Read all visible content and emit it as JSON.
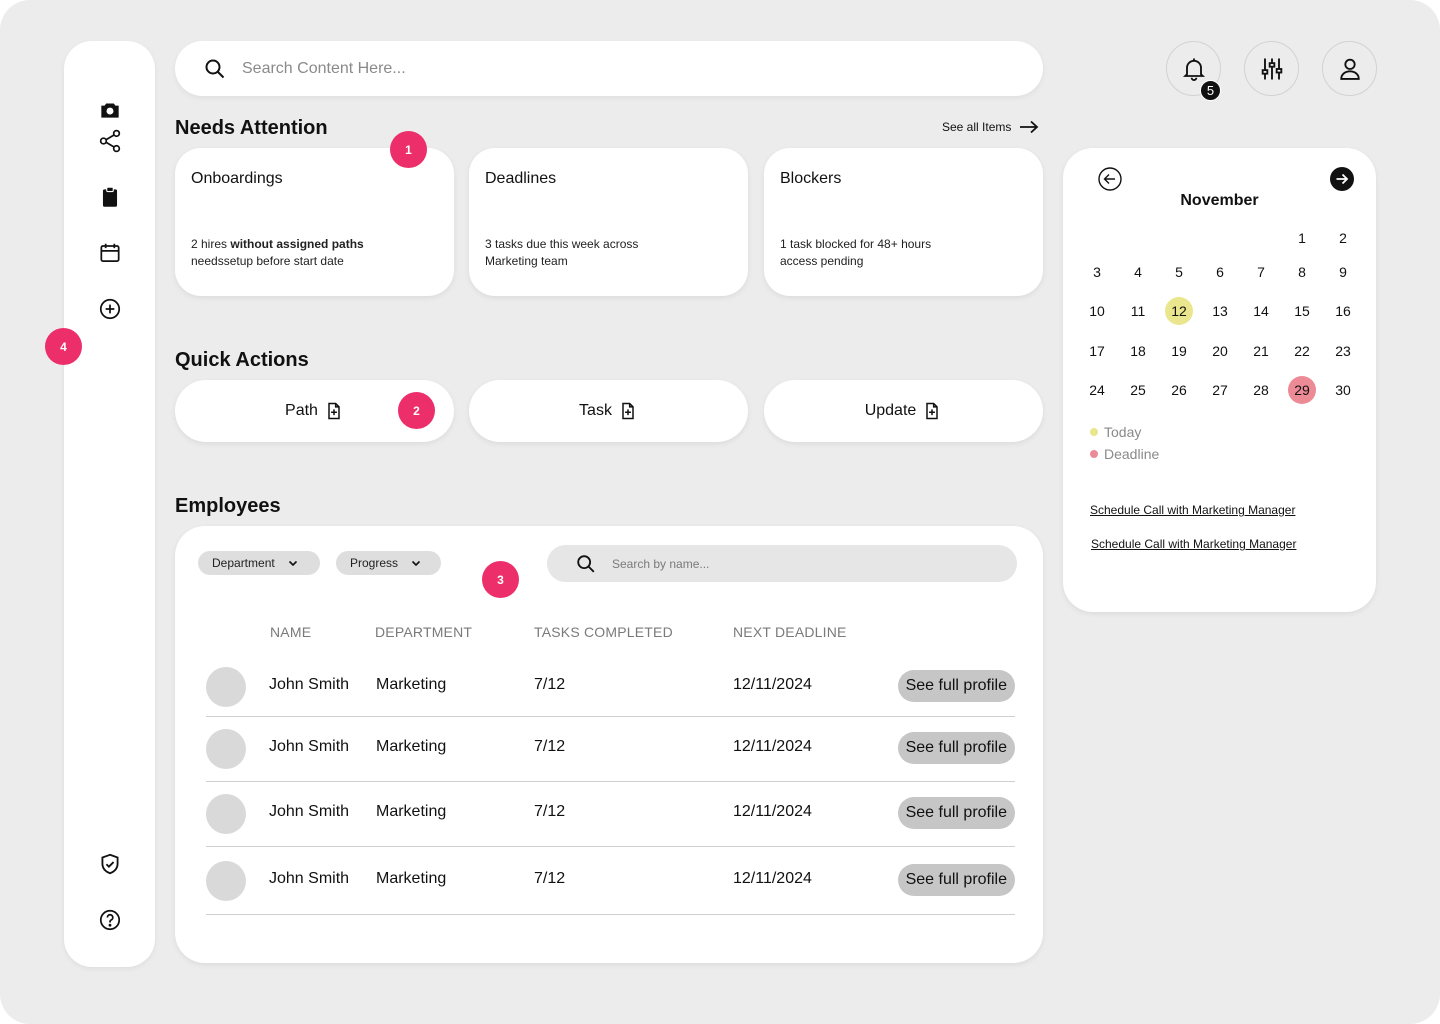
{
  "search": {
    "placeholder": "Search Content Here..."
  },
  "notifications": {
    "count": "5"
  },
  "needs_attention": {
    "title": "Needs Attention",
    "see_all": "See all Items",
    "cards": [
      {
        "title": "Onboardings",
        "desc_pre": "2 hires ",
        "desc_bold": "without assigned paths",
        "desc_post": "needssetup before start date"
      },
      {
        "title": "Deadlines",
        "desc_line1": "3 tasks due this week across",
        "desc_line2": "Marketing team"
      },
      {
        "title": "Blockers",
        "desc_line1": "1 task blocked for 48+ hours",
        "desc_line2": "access pending"
      }
    ]
  },
  "quick_actions": {
    "title": "Quick Actions",
    "items": [
      {
        "label": "Path"
      },
      {
        "label": "Task"
      },
      {
        "label": "Update"
      }
    ]
  },
  "employees": {
    "title": "Employees",
    "filters": [
      {
        "label": "Department"
      },
      {
        "label": "Progress"
      }
    ],
    "search_placeholder": "Search by name...",
    "columns": [
      "NAME",
      "DEPARTMENT",
      "TASKS COMPLETED",
      "NEXT DEADLINE"
    ],
    "rows": [
      {
        "name": "John Smith",
        "department": "Marketing",
        "tasks": "7/12",
        "deadline": "12/11/2024",
        "action": "See full profile"
      },
      {
        "name": "John Smith",
        "department": "Marketing",
        "tasks": "7/12",
        "deadline": "12/11/2024",
        "action": "See full profile"
      },
      {
        "name": "John Smith",
        "department": "Marketing",
        "tasks": "7/12",
        "deadline": "12/11/2024",
        "action": "See full profile"
      },
      {
        "name": "John Smith",
        "department": "Marketing",
        "tasks": "7/12",
        "deadline": "12/11/2024",
        "action": "See full profile"
      }
    ]
  },
  "calendar": {
    "month": "November",
    "weeks": [
      [
        "",
        "",
        "",
        "",
        "",
        "1",
        "2"
      ],
      [
        "3",
        "4",
        "5",
        "6",
        "7",
        "8",
        "9"
      ],
      [
        "10",
        "11",
        "12",
        "13",
        "14",
        "15",
        "16"
      ],
      [
        "17",
        "18",
        "19",
        "20",
        "21",
        "22",
        "23"
      ],
      [
        "24",
        "25",
        "26",
        "27",
        "28",
        "29",
        "30"
      ]
    ],
    "today": "12",
    "deadline_day": "29",
    "legend": {
      "today": "Today",
      "deadline": "Deadline"
    },
    "links": [
      "Schedule Call with Marketing Manager",
      "Schedule Call with Marketing Manager"
    ],
    "colors": {
      "today": "#eae68d",
      "deadline": "#ec8b96"
    }
  },
  "markers": [
    "1",
    "2",
    "3",
    "4"
  ],
  "colors": {
    "marker": "#ec2f6a",
    "background": "#ececec",
    "card": "#ffffff"
  },
  "sidebar": {
    "icons": [
      "camera-icon",
      "share-icon",
      "clipboard-icon",
      "calendar-icon",
      "plus-circle-icon",
      "shield-check-icon",
      "help-icon"
    ]
  }
}
